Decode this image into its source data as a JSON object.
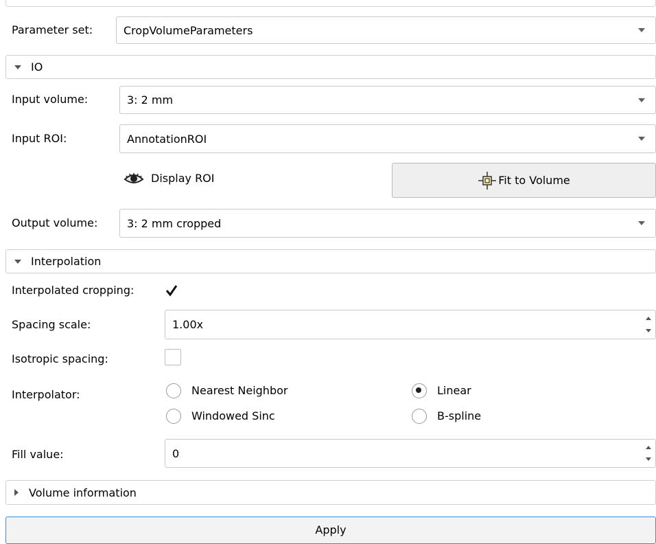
{
  "parameter_set": {
    "label": "Parameter set:",
    "value": "CropVolumeParameters"
  },
  "io": {
    "header": "IO",
    "input_volume": {
      "label": "Input volume:",
      "value": "3: 2 mm"
    },
    "input_roi": {
      "label": "Input ROI:",
      "value": "AnnotationROI"
    },
    "display_roi": {
      "label": "Display ROI",
      "icon": "eye-icon"
    },
    "fit_to_volume": {
      "label": "Fit to Volume",
      "icon": "fit-to-volume-icon"
    },
    "output_volume": {
      "label": "Output volume:",
      "value": "3: 2 mm cropped"
    }
  },
  "interpolation": {
    "header": "Interpolation",
    "interpolated_cropping": {
      "label": "Interpolated cropping:",
      "checked": true
    },
    "spacing_scale": {
      "label": "Spacing scale:",
      "value": "1.00x"
    },
    "isotropic_spacing": {
      "label": "Isotropic spacing:",
      "checked": false
    },
    "interpolator": {
      "label": "Interpolator:",
      "options": [
        {
          "label": "Nearest Neighbor",
          "selected": false
        },
        {
          "label": "Linear",
          "selected": true
        },
        {
          "label": "Windowed Sinc",
          "selected": false
        },
        {
          "label": "B-spline",
          "selected": false
        }
      ]
    },
    "fill_value": {
      "label": "Fill value:",
      "value": "0"
    }
  },
  "volume_information": {
    "header": "Volume information"
  },
  "apply": {
    "label": "Apply"
  }
}
